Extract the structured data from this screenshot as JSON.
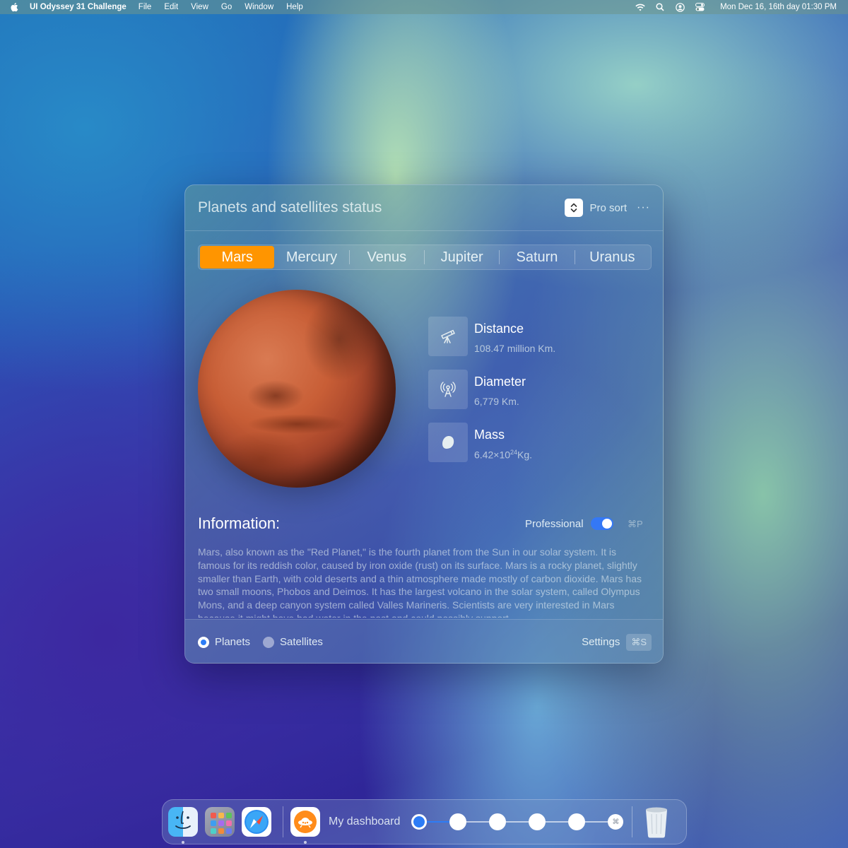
{
  "menubar": {
    "app_name": "UI Odyssey 31 Challenge",
    "menus": [
      "File",
      "Edit",
      "View",
      "Go",
      "Window",
      "Help"
    ],
    "clock": "Mon Dec 16, 16th day  01:30 PM"
  },
  "window": {
    "title": "Planets and satellites status",
    "sort_label": "Pro sort",
    "more": "···",
    "tabs": [
      "Mars",
      "Mercury",
      "Venus",
      "Jupiter",
      "Saturn",
      "Uranus"
    ],
    "active_tab": "Mars",
    "stats": {
      "distance": {
        "label": "Distance",
        "value": "108.47 million Km.",
        "icon": "telescope-icon"
      },
      "diameter": {
        "label": "Diameter",
        "value": "6,779 Km.",
        "icon": "antenna-icon"
      },
      "mass": {
        "label": "Mass",
        "value_base": "6.42",
        "value_times": "×",
        "value_pow": "10",
        "value_exp": "24",
        "value_unit": "Kg.",
        "icon": "planet-shape-icon"
      }
    },
    "info": {
      "title": "Information:",
      "professional_label": "Professional",
      "professional_on": true,
      "shortcut": "⌘P",
      "body": "Mars, also known as the \"Red Planet,\" is the fourth planet from the Sun in our solar system. It is famous for its reddish color, caused by iron oxide (rust) on its surface. Mars is a rocky planet, slightly smaller than Earth, with cold deserts and a thin atmosphere made mostly of carbon dioxide. Mars has two small moons, Phobos and Deimos. It has the largest volcano in the solar system, called Olympus Mons, and a deep canyon system called Valles Marineris. Scientists are very interested in Mars because it might have had water in the past and could possibly support"
    },
    "footer": {
      "radio_planets": "Planets",
      "radio_satellites": "Satellites",
      "selected": "Planets",
      "settings_label": "Settings",
      "settings_shortcut": "⌘S"
    }
  },
  "dock": {
    "apps": [
      "finder-icon",
      "launchpad-icon",
      "safari-icon",
      "my-dashboard-app-icon",
      "trash-icon"
    ],
    "dashboard_label": "My dashboard",
    "steps_total": 6,
    "steps_current": 1,
    "last_step_glyph": "⌘"
  },
  "colors": {
    "accent_orange": "#ff9500",
    "accent_blue": "#2d7cf6"
  }
}
